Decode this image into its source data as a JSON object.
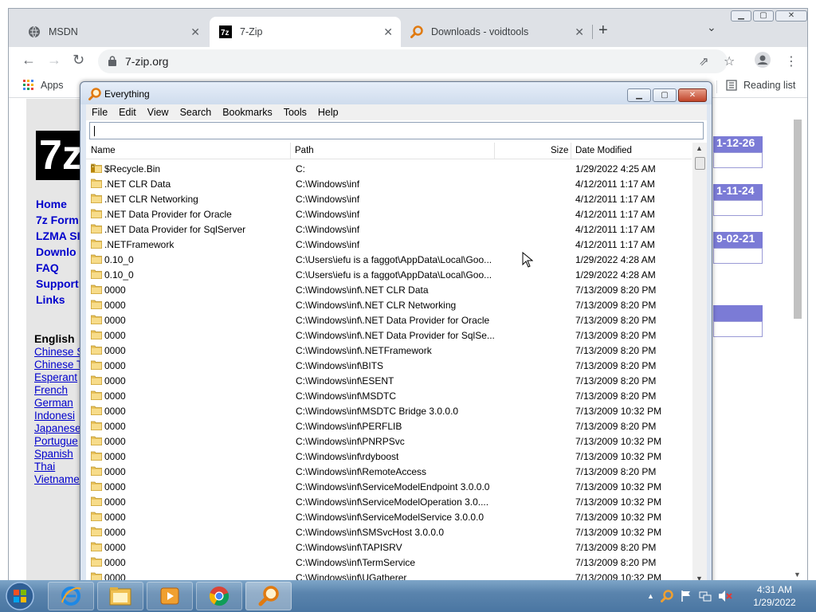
{
  "browser": {
    "tabs": [
      {
        "label": "MSDN",
        "icon": "globe-icon"
      },
      {
        "label": "7-Zip",
        "icon": "7zip-icon"
      },
      {
        "label": "Downloads - voidtools",
        "icon": "magnifier-icon"
      }
    ],
    "url": "7-zip.org",
    "bookmarks": {
      "apps": "Apps",
      "reading_list": "Reading list"
    }
  },
  "webpage": {
    "logo": "7z",
    "nav": [
      "Home",
      "7z Form",
      "LZMA SI",
      "Downlo",
      "FAQ",
      "Support",
      "Links"
    ],
    "lang_heading": "English",
    "languages": [
      "Chinese S",
      "Chinese T",
      "Esperant",
      "French",
      "German",
      "Indonesi",
      "Japanese",
      "Portugue",
      "Spanish",
      "Thai",
      "Vietname"
    ],
    "dates": [
      "1-12-26",
      "1-11-24",
      "9-02-21"
    ]
  },
  "everything": {
    "title": "Everything",
    "menu": [
      "File",
      "Edit",
      "View",
      "Search",
      "Bookmarks",
      "Tools",
      "Help"
    ],
    "search_value": "",
    "columns": {
      "name": "Name",
      "path": "Path",
      "size": "Size",
      "date": "Date Modified"
    },
    "rows": [
      {
        "name": "$Recycle.Bin",
        "path": "C:",
        "date": "1/29/2022 4:25 AM",
        "icon": "recycle-folder-icon"
      },
      {
        "name": ".NET CLR Data",
        "path": "C:\\Windows\\inf",
        "date": "4/12/2011 1:17 AM"
      },
      {
        "name": ".NET CLR Networking",
        "path": "C:\\Windows\\inf",
        "date": "4/12/2011 1:17 AM"
      },
      {
        "name": ".NET Data Provider for Oracle",
        "path": "C:\\Windows\\inf",
        "date": "4/12/2011 1:17 AM"
      },
      {
        "name": ".NET Data Provider for SqlServer",
        "path": "C:\\Windows\\inf",
        "date": "4/12/2011 1:17 AM"
      },
      {
        "name": ".NETFramework",
        "path": "C:\\Windows\\inf",
        "date": "4/12/2011 1:17 AM"
      },
      {
        "name": "0.10_0",
        "path": "C:\\Users\\iefu is a faggot\\AppData\\Local\\Goo...",
        "date": "1/29/2022 4:28 AM"
      },
      {
        "name": "0.10_0",
        "path": "C:\\Users\\iefu is a faggot\\AppData\\Local\\Goo...",
        "date": "1/29/2022 4:28 AM"
      },
      {
        "name": "0000",
        "path": "C:\\Windows\\inf\\.NET CLR Data",
        "date": "7/13/2009 8:20 PM"
      },
      {
        "name": "0000",
        "path": "C:\\Windows\\inf\\.NET CLR Networking",
        "date": "7/13/2009 8:20 PM"
      },
      {
        "name": "0000",
        "path": "C:\\Windows\\inf\\.NET Data Provider for Oracle",
        "date": "7/13/2009 8:20 PM"
      },
      {
        "name": "0000",
        "path": "C:\\Windows\\inf\\.NET Data Provider for SqlSe...",
        "date": "7/13/2009 8:20 PM"
      },
      {
        "name": "0000",
        "path": "C:\\Windows\\inf\\.NETFramework",
        "date": "7/13/2009 8:20 PM"
      },
      {
        "name": "0000",
        "path": "C:\\Windows\\inf\\BITS",
        "date": "7/13/2009 8:20 PM"
      },
      {
        "name": "0000",
        "path": "C:\\Windows\\inf\\ESENT",
        "date": "7/13/2009 8:20 PM"
      },
      {
        "name": "0000",
        "path": "C:\\Windows\\inf\\MSDTC",
        "date": "7/13/2009 8:20 PM"
      },
      {
        "name": "0000",
        "path": "C:\\Windows\\inf\\MSDTC Bridge 3.0.0.0",
        "date": "7/13/2009 10:32 PM"
      },
      {
        "name": "0000",
        "path": "C:\\Windows\\inf\\PERFLIB",
        "date": "7/13/2009 8:20 PM"
      },
      {
        "name": "0000",
        "path": "C:\\Windows\\inf\\PNRPSvc",
        "date": "7/13/2009 10:32 PM"
      },
      {
        "name": "0000",
        "path": "C:\\Windows\\inf\\rdyboost",
        "date": "7/13/2009 10:32 PM"
      },
      {
        "name": "0000",
        "path": "C:\\Windows\\inf\\RemoteAccess",
        "date": "7/13/2009 8:20 PM"
      },
      {
        "name": "0000",
        "path": "C:\\Windows\\inf\\ServiceModelEndpoint 3.0.0.0",
        "date": "7/13/2009 10:32 PM"
      },
      {
        "name": "0000",
        "path": "C:\\Windows\\inf\\ServiceModelOperation 3.0....",
        "date": "7/13/2009 10:32 PM"
      },
      {
        "name": "0000",
        "path": "C:\\Windows\\inf\\ServiceModelService 3.0.0.0",
        "date": "7/13/2009 10:32 PM"
      },
      {
        "name": "0000",
        "path": "C:\\Windows\\inf\\SMSvcHost 3.0.0.0",
        "date": "7/13/2009 10:32 PM"
      },
      {
        "name": "0000",
        "path": "C:\\Windows\\inf\\TAPISRV",
        "date": "7/13/2009 8:20 PM"
      },
      {
        "name": "0000",
        "path": "C:\\Windows\\inf\\TermService",
        "date": "7/13/2009 8:20 PM"
      },
      {
        "name": "0000",
        "path": "C:\\Windows\\inf\\UGatherer",
        "date": "7/13/2009 10:32 PM"
      }
    ]
  },
  "taskbar": {
    "apps": [
      "internet-explorer-icon",
      "file-explorer-icon",
      "media-player-icon",
      "chrome-icon",
      "everything-icon"
    ],
    "time": "4:31 AM",
    "date": "1/29/2022"
  },
  "colors": {
    "accent": "#0000cc",
    "date_box": "#7b7bd6",
    "tabstrip": "#dee1e6"
  }
}
